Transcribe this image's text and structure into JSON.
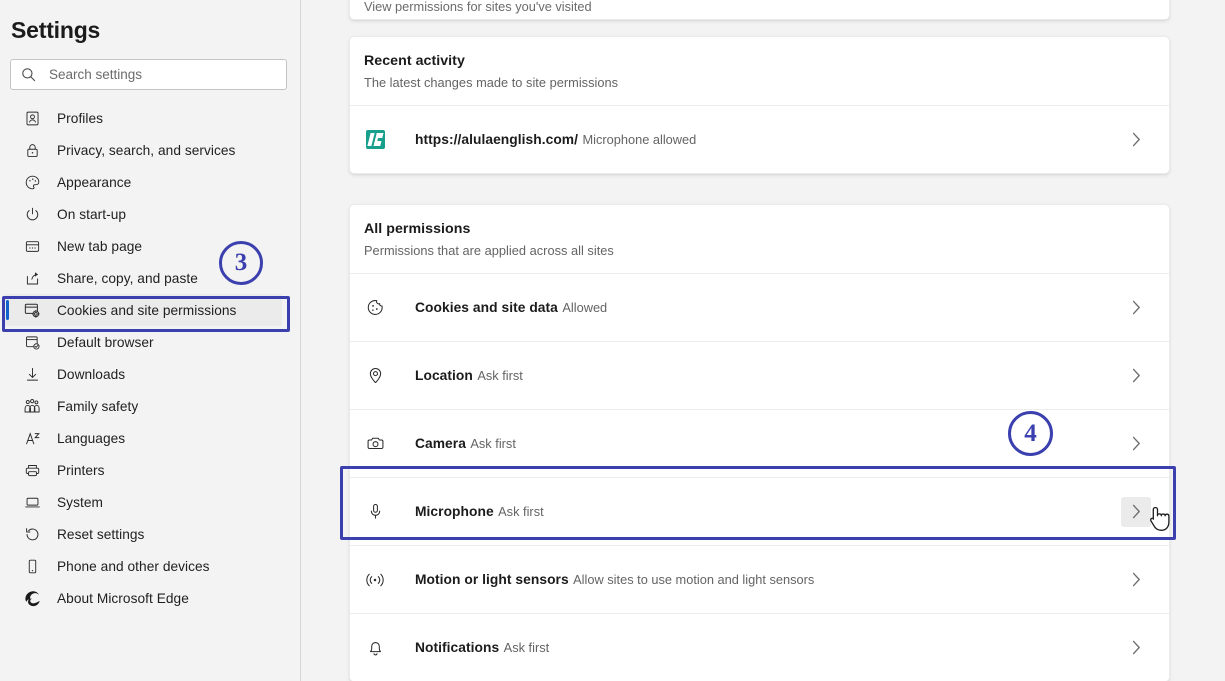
{
  "sidebar": {
    "title": "Settings",
    "search": {
      "placeholder": "Search settings",
      "value": "",
      "icon": "search-icon"
    },
    "items": [
      {
        "label": "Profiles",
        "icon": "profile-card-icon",
        "selected": false
      },
      {
        "label": "Privacy, search, and services",
        "icon": "lock-icon",
        "selected": false
      },
      {
        "label": "Appearance",
        "icon": "palette-icon",
        "selected": false
      },
      {
        "label": "On start-up",
        "icon": "power-icon",
        "selected": false
      },
      {
        "label": "New tab page",
        "icon": "new-tab-page-icon",
        "selected": false
      },
      {
        "label": "Share, copy, and paste",
        "icon": "share-icon",
        "selected": false
      },
      {
        "label": "Cookies and site permissions",
        "icon": "cookies-permissions-icon",
        "selected": true
      },
      {
        "label": "Default browser",
        "icon": "default-browser-icon",
        "selected": false
      },
      {
        "label": "Downloads",
        "icon": "download-arrow-icon",
        "selected": false
      },
      {
        "label": "Family safety",
        "icon": "family-icon",
        "selected": false
      },
      {
        "label": "Languages",
        "icon": "languages-icon",
        "selected": false
      },
      {
        "label": "Printers",
        "icon": "printer-icon",
        "selected": false
      },
      {
        "label": "System",
        "icon": "laptop-icon",
        "selected": false
      },
      {
        "label": "Reset settings",
        "icon": "reset-arrow-icon",
        "selected": false
      },
      {
        "label": "Phone and other devices",
        "icon": "phone-icon",
        "selected": false
      },
      {
        "label": "About Microsoft Edge",
        "icon": "edge-logo-icon",
        "selected": false
      }
    ]
  },
  "main": {
    "partial_card": {
      "subtitle": "View permissions for sites you've visited"
    },
    "recent_activity": {
      "title": "Recent activity",
      "subtitle": "The latest changes made to site permissions",
      "entries": [
        {
          "site": "https://alulaenglish.com/",
          "status": "Microphone allowed",
          "icon": "site-favicon",
          "chevron": "chevron-right-icon"
        }
      ]
    },
    "all_permissions": {
      "title": "All permissions",
      "subtitle": "Permissions that are applied across all sites",
      "entries": [
        {
          "name": "Cookies and site data",
          "status": "Allowed",
          "icon": "cookie-icon",
          "chevron": "chevron-right-icon",
          "highlighted": false,
          "chevron_hovered": false
        },
        {
          "name": "Location",
          "status": "Ask first",
          "icon": "location-pin-icon",
          "chevron": "chevron-right-icon",
          "highlighted": false,
          "chevron_hovered": false
        },
        {
          "name": "Camera",
          "status": "Ask first",
          "icon": "camera-icon",
          "chevron": "chevron-right-icon",
          "highlighted": false,
          "chevron_hovered": false
        },
        {
          "name": "Microphone",
          "status": "Ask first",
          "icon": "microphone-icon",
          "chevron": "chevron-right-icon",
          "highlighted": true,
          "chevron_hovered": true
        },
        {
          "name": "Motion or light sensors",
          "status": "Allow sites to use motion and light sensors",
          "icon": "motion-sensor-icon",
          "chevron": "chevron-right-icon",
          "highlighted": false,
          "chevron_hovered": false
        },
        {
          "name": "Notifications",
          "status": "Ask first",
          "icon": "bell-icon",
          "chevron": "chevron-right-icon",
          "highlighted": false,
          "chevron_hovered": false
        }
      ]
    }
  },
  "annotations": {
    "color": "#3b40ae",
    "markers": [
      {
        "number": "3",
        "target": "sidebar-item-cookies-and-site-permissions"
      },
      {
        "number": "4",
        "target": "permission-row-microphone"
      }
    ],
    "boxes": [
      {
        "target": "sidebar-item-cookies-and-site-permissions"
      },
      {
        "target": "permission-row-microphone"
      }
    ]
  },
  "cursor": {
    "type": "hand-pointer",
    "over": "permission-row-microphone-chevron"
  },
  "colors": {
    "accent": "#0f62cc",
    "annotation": "#3b40ae",
    "page_bg": "#f3f3f3",
    "card_bg": "#ffffff",
    "favicon": "#18a08c"
  }
}
